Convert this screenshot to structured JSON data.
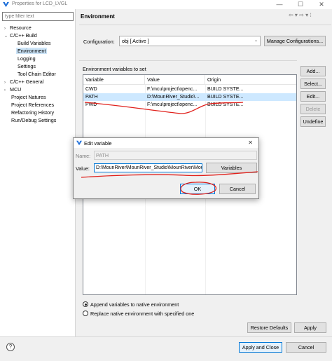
{
  "window": {
    "title": "Properties for LCD_LVGL",
    "minimize": "—",
    "maximize": "☐",
    "close": "✕"
  },
  "tree": {
    "filter_placeholder": "type filter text",
    "items": [
      {
        "label": "Resource",
        "arrow": "›"
      },
      {
        "label": "C/C++ Build",
        "arrow": "⌄"
      },
      {
        "label": "Build Variables"
      },
      {
        "label": "Environment"
      },
      {
        "label": "Logging"
      },
      {
        "label": "Settings"
      },
      {
        "label": "Tool Chain Editor"
      },
      {
        "label": "C/C++ General",
        "arrow": "›"
      },
      {
        "label": "MCU",
        "arrow": "›"
      },
      {
        "label": "Project Natures"
      },
      {
        "label": "Project References"
      },
      {
        "label": "Refactoring History"
      },
      {
        "label": "Run/Debug Settings"
      }
    ]
  },
  "page": {
    "title": "Environment",
    "nav": "⇦ ▾ ⇨ ▾ ⁝"
  },
  "config": {
    "label": "Configuration:",
    "value": "obj  [ Active ]",
    "arrow": "⌄",
    "manage_button": "Manage Configurations..."
  },
  "env": {
    "label": "Environment variables to set",
    "columns": [
      "Variable",
      "Value",
      "Origin"
    ],
    "rows": [
      {
        "variable": "CWD",
        "value": "F:\\mcu\\project\\openc...",
        "origin": "BUILD SYSTE..."
      },
      {
        "variable": "PATH",
        "value": "D:\\MounRiver_Studio\\...",
        "origin": "BUILD SYSTE..."
      },
      {
        "variable": "PWD",
        "value": "F:\\mcu\\project\\openc...",
        "origin": "BUILD SYSTE..."
      }
    ],
    "selected_row": 1
  },
  "side_buttons": {
    "add": "Add...",
    "select": "Select...",
    "edit": "Edit...",
    "delete": "Delete",
    "undefine": "Undefine"
  },
  "radios": {
    "append": "Append variables to native environment",
    "replace": "Replace native environment with specified one"
  },
  "buttons": {
    "restore": "Restore Defaults",
    "apply": "Apply",
    "apply_close": "Apply and Close",
    "cancel": "Cancel",
    "help": "?"
  },
  "dialog": {
    "title": "Edit variable",
    "close": "✕",
    "name_label": "Name:",
    "name_value": "PATH",
    "value_label": "Value:",
    "value_value": "D:\\MounRiver\\MounRiver_Studio\\MounRiver\\MounRiver_",
    "variables_button": "Variables",
    "ok": "OK",
    "cancel": "Cancel"
  },
  "colors": {
    "accent": "#0078d7",
    "selection": "#cde8ff",
    "annotation": "#e0201b"
  }
}
